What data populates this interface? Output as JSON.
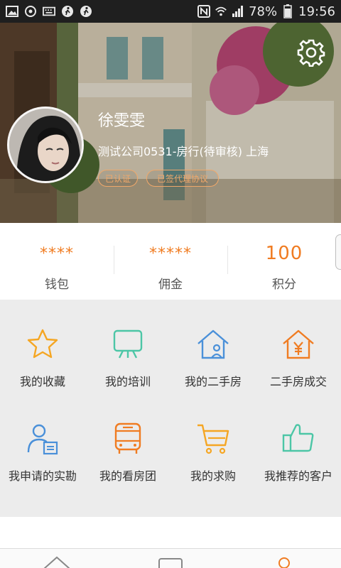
{
  "status_bar": {
    "battery": "78%",
    "time": "19:56",
    "left_icons": [
      "image-icon",
      "sync-icon",
      "keyboard-icon",
      "walk-icon",
      "walk-icon"
    ],
    "right_icons": [
      "nfc-icon",
      "wifi-icon",
      "signal-icon",
      "battery-icon"
    ]
  },
  "profile": {
    "name": "徐雯雯",
    "company": "测试公司0531-房行(待审核)  上海",
    "badge_verified": "已认证",
    "badge_agreement": "已签代理协议"
  },
  "stats": [
    {
      "value": "****",
      "label": "钱包"
    },
    {
      "value": "*****",
      "label": "佣金"
    },
    {
      "value": "100",
      "label": "积分"
    }
  ],
  "menu": [
    {
      "label": "我的收藏",
      "icon": "star-icon",
      "color": "#f5a623"
    },
    {
      "label": "我的培训",
      "icon": "presentation-board-icon",
      "color": "#4cc6a6"
    },
    {
      "label": "我的二手房",
      "icon": "house-user-icon",
      "color": "#4a90d9"
    },
    {
      "label": "二手房成交",
      "icon": "house-yen-icon",
      "color": "#f07c22"
    },
    {
      "label": "我申请的实勘",
      "icon": "person-document-icon",
      "color": "#4a90d9"
    },
    {
      "label": "我的看房团",
      "icon": "bus-icon",
      "color": "#f07c22"
    },
    {
      "label": "我的求购",
      "icon": "shopping-cart-icon",
      "color": "#f5a623"
    },
    {
      "label": "我推荐的客户",
      "icon": "thumbs-up-icon",
      "color": "#4cc6a6"
    }
  ],
  "bottom_nav": [
    "home-icon",
    "message-icon",
    "profile-icon"
  ],
  "colors": {
    "accent": "#f07c22",
    "grid_bg": "#ececec"
  }
}
